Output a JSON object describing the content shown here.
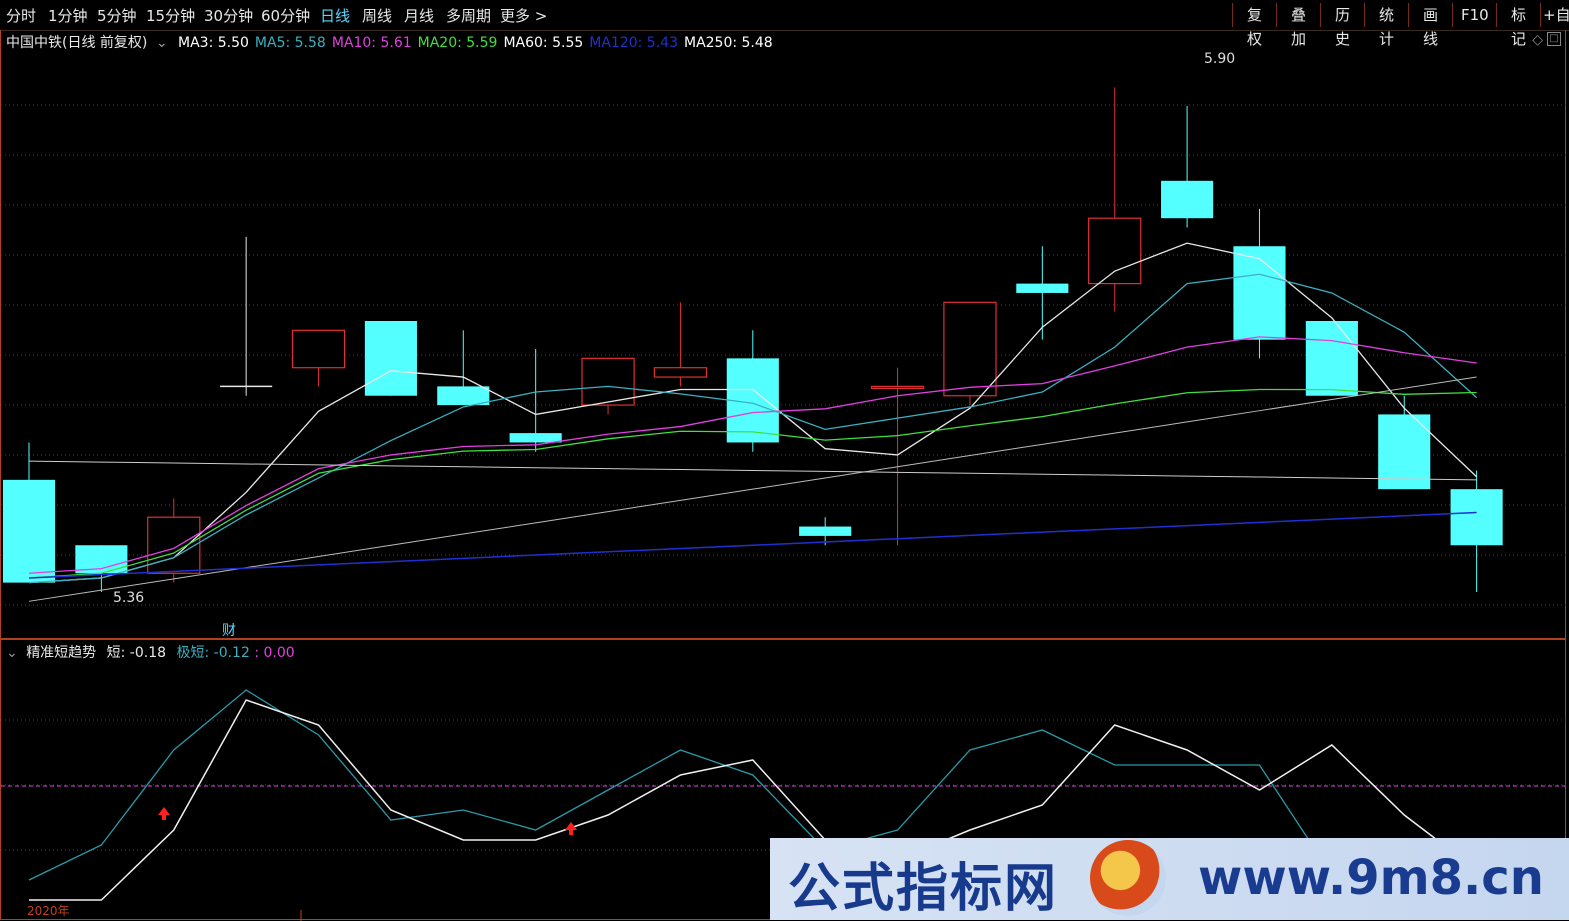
{
  "toolbar": {
    "timeframes": [
      "分时",
      "1分钟",
      "5分钟",
      "15分钟",
      "30分钟",
      "60分钟",
      "日线",
      "周线",
      "月线",
      "多周期",
      "更多"
    ],
    "active": "日线",
    "right_buttons": [
      "复权",
      "叠加",
      "历史",
      "统计",
      "画线",
      "F10",
      "标记",
      "+自"
    ]
  },
  "main_chart": {
    "stock_title": "中国中铁(日线 前复权)",
    "ma_legend": [
      {
        "label": "MA3: 5.50",
        "color": "#ffffff"
      },
      {
        "label": "MA5: 5.58",
        "color": "#3ab0c0"
      },
      {
        "label": "MA10: 5.61",
        "color": "#e040e0"
      },
      {
        "label": "MA20: 5.59",
        "color": "#40e040"
      },
      {
        "label": "MA60: 5.55",
        "color": "#ffffff"
      },
      {
        "label": "MA120: 5.43",
        "color": "#2030d0"
      },
      {
        "label": "MA250: 5.48",
        "color": "#ffffff"
      }
    ],
    "high_label": "5.90",
    "low_label": "5.36",
    "finance_marker": "财"
  },
  "sub_chart": {
    "indicator_name": "精准短趋势",
    "short_label": "短: -0.18",
    "extreme_label": "极短: -0.12",
    "zero_label": ": 0.00"
  },
  "bottom_axis": {
    "year_label": "2020年"
  },
  "watermark": {
    "left": "公式指标网",
    "right": "www.9m8.cn"
  },
  "chart_data": {
    "type": "candlestick",
    "price_range": [
      5.33,
      5.94
    ],
    "candles": [
      {
        "o": 5.48,
        "h": 5.52,
        "l": 5.4,
        "c": 5.37,
        "color": "cyan"
      },
      {
        "o": 5.41,
        "h": 5.41,
        "l": 5.36,
        "c": 5.38,
        "color": "cyan"
      },
      {
        "o": 5.38,
        "h": 5.46,
        "l": 5.37,
        "c": 5.44,
        "color": "red"
      },
      {
        "o": 5.58,
        "h": 5.74,
        "l": 5.57,
        "c": 5.58,
        "color": "white"
      },
      {
        "o": 5.6,
        "h": 5.63,
        "l": 5.58,
        "c": 5.64,
        "color": "red"
      },
      {
        "o": 5.65,
        "h": 5.65,
        "l": 5.57,
        "c": 5.57,
        "color": "cyan"
      },
      {
        "o": 5.58,
        "h": 5.64,
        "l": 5.56,
        "c": 5.56,
        "color": "cyan"
      },
      {
        "o": 5.53,
        "h": 5.62,
        "l": 5.51,
        "c": 5.52,
        "color": "cyan"
      },
      {
        "o": 5.56,
        "h": 5.61,
        "l": 5.55,
        "c": 5.61,
        "color": "red"
      },
      {
        "o": 5.59,
        "h": 5.67,
        "l": 5.58,
        "c": 5.6,
        "color": "red"
      },
      {
        "o": 5.61,
        "h": 5.64,
        "l": 5.51,
        "c": 5.52,
        "color": "cyan"
      },
      {
        "o": 5.43,
        "h": 5.44,
        "l": 5.41,
        "c": 5.42,
        "color": "cyan"
      },
      {
        "o": 5.58,
        "h": 5.6,
        "l": 5.41,
        "c": 5.58,
        "color": "red"
      },
      {
        "o": 5.57,
        "h": 5.67,
        "l": 5.56,
        "c": 5.67,
        "color": "red"
      },
      {
        "o": 5.69,
        "h": 5.73,
        "l": 5.63,
        "c": 5.68,
        "color": "cyan"
      },
      {
        "o": 5.69,
        "h": 5.9,
        "l": 5.66,
        "c": 5.76,
        "color": "red"
      },
      {
        "o": 5.8,
        "h": 5.88,
        "l": 5.75,
        "c": 5.76,
        "color": "cyan"
      },
      {
        "o": 5.73,
        "h": 5.77,
        "l": 5.61,
        "c": 5.63,
        "color": "cyan"
      },
      {
        "o": 5.65,
        "h": 5.65,
        "l": 5.57,
        "c": 5.57,
        "color": "cyan"
      },
      {
        "o": 5.55,
        "h": 5.57,
        "l": 5.47,
        "c": 5.47,
        "color": "cyan"
      },
      {
        "o": 5.47,
        "h": 5.49,
        "l": 5.36,
        "c": 5.41,
        "color": "cyan"
      }
    ]
  }
}
